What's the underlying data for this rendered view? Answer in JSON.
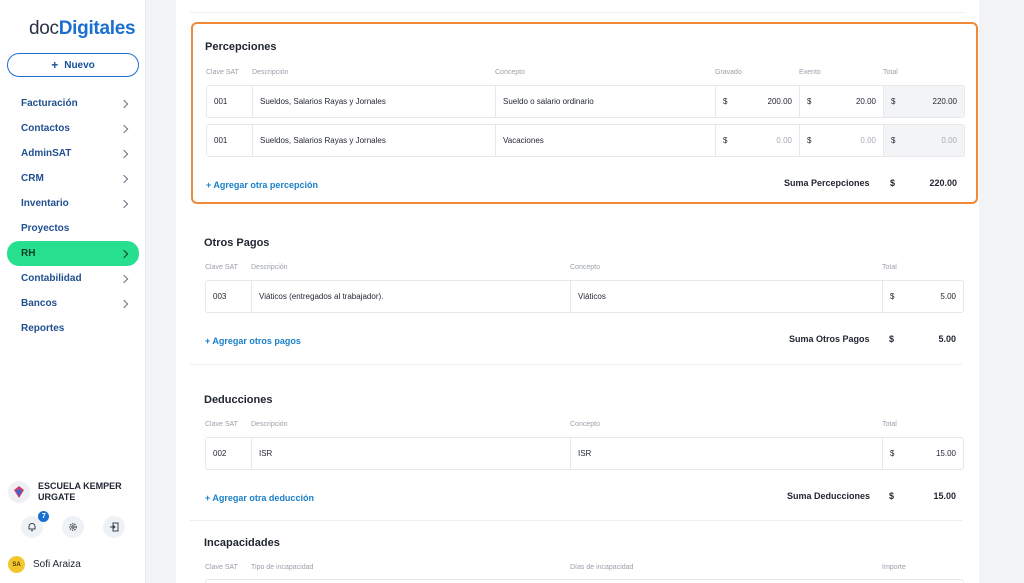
{
  "brand": {
    "part1": "doc",
    "part2": "Digitales"
  },
  "sidebar": {
    "new_button": "Nuevo",
    "items": [
      {
        "label": "Facturación",
        "chevron": true
      },
      {
        "label": "Contactos",
        "chevron": true
      },
      {
        "label": "AdminSAT",
        "chevron": true
      },
      {
        "label": "CRM",
        "chevron": true
      },
      {
        "label": "Inventario",
        "chevron": true
      },
      {
        "label": "Proyectos",
        "chevron": false
      },
      {
        "label": "RH",
        "chevron": true,
        "active": true
      },
      {
        "label": "Contabilidad",
        "chevron": true
      },
      {
        "label": "Bancos",
        "chevron": true
      },
      {
        "label": "Reportes",
        "chevron": false
      }
    ],
    "org_name": "ESCUELA KEMPER URGATE",
    "notifications_count": "7",
    "user_initials": "SA",
    "user_name": "Sofi Araiza"
  },
  "percepciones": {
    "title": "Percepciones",
    "headers": {
      "clave": "Clave SAT",
      "descripcion": "Descripción",
      "concepto": "Concepto",
      "gravado": "Gravado",
      "exento": "Exento",
      "total": "Total"
    },
    "rows": [
      {
        "clave": "001",
        "descripcion": "Sueldos, Salarios Rayas y Jornales",
        "concepto": "Sueldo o salario ordinario",
        "gravado": "200.00",
        "exento": "20.00",
        "total": "220.00"
      },
      {
        "clave": "001",
        "descripcion": "Sueldos, Salarios Rayas y Jornales",
        "concepto": "Vacaciones",
        "gravado": "0.00",
        "exento": "0.00",
        "total": "0.00"
      }
    ],
    "add_link": "+ Agregar otra percepción",
    "sum_label": "Suma Percepciones",
    "sum_value": "220.00"
  },
  "otros_pagos": {
    "title": "Otros Pagos",
    "headers": {
      "clave": "Clave SAT",
      "descripcion": "Descripción",
      "concepto": "Concepto",
      "total": "Total"
    },
    "rows": [
      {
        "clave": "003",
        "descripcion": "Viáticos (entregados al trabajador).",
        "concepto": "Viáticos",
        "total": "5.00"
      }
    ],
    "add_link": "+ Agregar otros pagos",
    "sum_label": "Suma Otros Pagos",
    "sum_value": "5.00"
  },
  "deducciones": {
    "title": "Deducciones",
    "headers": {
      "clave": "Clave SAT",
      "descripcion": "Descripción",
      "concepto": "Concepto",
      "total": "Total"
    },
    "rows": [
      {
        "clave": "002",
        "descripcion": "ISR",
        "concepto": "ISR",
        "total": "15.00"
      }
    ],
    "add_link": "+ Agregar otra deducción",
    "sum_label": "Suma Deducciones",
    "sum_value": "15.00"
  },
  "incapacidades": {
    "title": "Incapacidades",
    "headers": {
      "clave": "Clave SAT",
      "tipo": "Tipo de incapacidad",
      "dias": "Días de incapacidad",
      "importe": "Importe"
    }
  },
  "currency_symbol": "$",
  "colors": {
    "accent": "#1a6fd0",
    "active_nav": "#27e08f",
    "highlight_border": "#ee8a3a",
    "link": "#1a7fc9"
  }
}
